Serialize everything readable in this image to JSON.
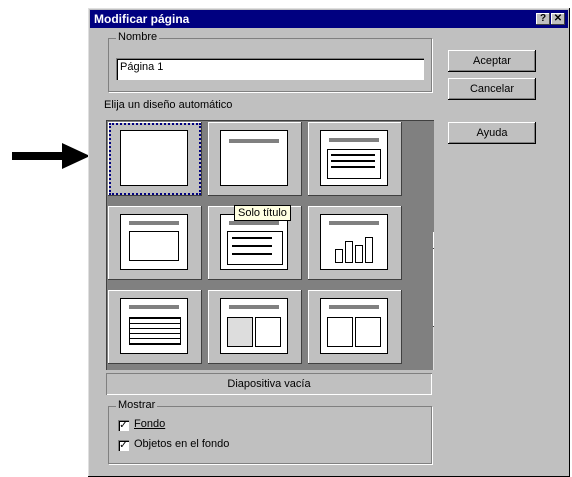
{
  "window": {
    "title": "Modificar página",
    "help_glyph": "?",
    "close_glyph": "✕"
  },
  "name_group": {
    "legend": "Nombre",
    "value": "Página 1"
  },
  "layout_label": "Elija un diseño automático",
  "buttons": {
    "accept": "Aceptar",
    "cancel": "Cancelar",
    "help": "Ayuda"
  },
  "tooltip": "Solo título",
  "status_text": "Diapositiva vacía",
  "show_group": {
    "legend": "Mostrar",
    "background": "Fondo",
    "background_objects": "Objetos en el fondo",
    "checked": "✓"
  },
  "arrow_icon": "➡",
  "scroll_up": "▲",
  "scroll_down": "▼"
}
